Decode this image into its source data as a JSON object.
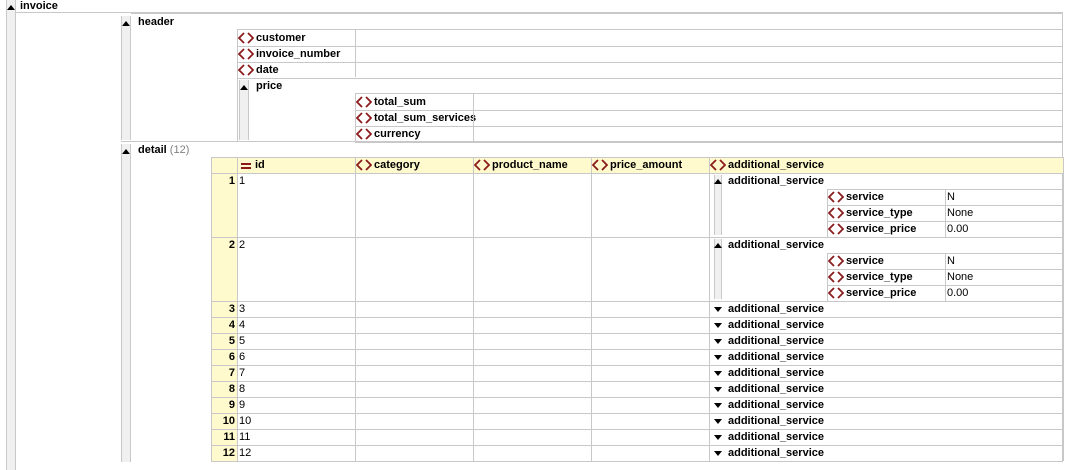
{
  "root": {
    "label": "invoice"
  },
  "header": {
    "label": "header",
    "fields": [
      "customer",
      "invoice_number",
      "date"
    ],
    "price": {
      "label": "price",
      "fields": [
        "total_sum",
        "total_sum_services",
        "currency"
      ]
    }
  },
  "detail": {
    "label": "detail",
    "count": "(12)",
    "columns": [
      "id",
      "category",
      "product_name",
      "price_amount",
      "additional_service"
    ],
    "rows": [
      {
        "num": "1",
        "id": "1",
        "additional_service": "additional_service",
        "expanded": true,
        "sub": [
          {
            "name": "service",
            "value": "N"
          },
          {
            "name": "service_type",
            "value": "None"
          },
          {
            "name": "service_price",
            "value": "0.00"
          }
        ]
      },
      {
        "num": "2",
        "id": "2",
        "additional_service": "additional_service",
        "expanded": true,
        "sub": [
          {
            "name": "service",
            "value": "N"
          },
          {
            "name": "service_type",
            "value": "None"
          },
          {
            "name": "service_price",
            "value": "0.00"
          }
        ]
      },
      {
        "num": "3",
        "id": "3",
        "additional_service": "additional_service",
        "expanded": false
      },
      {
        "num": "4",
        "id": "4",
        "additional_service": "additional_service",
        "expanded": false
      },
      {
        "num": "5",
        "id": "5",
        "additional_service": "additional_service",
        "expanded": false
      },
      {
        "num": "6",
        "id": "6",
        "additional_service": "additional_service",
        "expanded": false
      },
      {
        "num": "7",
        "id": "7",
        "additional_service": "additional_service",
        "expanded": false
      },
      {
        "num": "8",
        "id": "8",
        "additional_service": "additional_service",
        "expanded": false
      },
      {
        "num": "9",
        "id": "9",
        "additional_service": "additional_service",
        "expanded": false
      },
      {
        "num": "10",
        "id": "10",
        "additional_service": "additional_service",
        "expanded": false
      },
      {
        "num": "11",
        "id": "11",
        "additional_service": "additional_service",
        "expanded": false
      },
      {
        "num": "12",
        "id": "12",
        "additional_service": "additional_service",
        "expanded": false
      }
    ]
  },
  "colors": {
    "element_icon": "#8b1a1a",
    "highlight": "#fffacd",
    "grid": "#c8c8c8",
    "gutter": "#f0f0f0"
  },
  "icons": {
    "element": "element-brackets-icon",
    "key": "equals-key-icon",
    "expand": "triangle-up-icon",
    "collapse": "triangle-down-icon"
  }
}
